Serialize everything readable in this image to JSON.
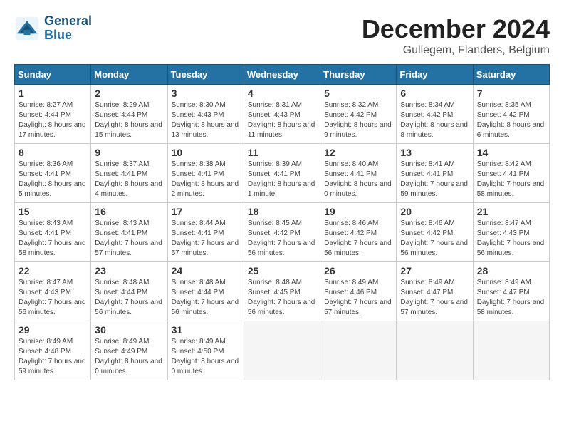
{
  "header": {
    "logo_line1": "General",
    "logo_line2": "Blue",
    "month": "December 2024",
    "location": "Gullegem, Flanders, Belgium"
  },
  "weekdays": [
    "Sunday",
    "Monday",
    "Tuesday",
    "Wednesday",
    "Thursday",
    "Friday",
    "Saturday"
  ],
  "weeks": [
    [
      {
        "day": "1",
        "info": "Sunrise: 8:27 AM\nSunset: 4:44 PM\nDaylight: 8 hours and 17 minutes."
      },
      {
        "day": "2",
        "info": "Sunrise: 8:29 AM\nSunset: 4:44 PM\nDaylight: 8 hours and 15 minutes."
      },
      {
        "day": "3",
        "info": "Sunrise: 8:30 AM\nSunset: 4:43 PM\nDaylight: 8 hours and 13 minutes."
      },
      {
        "day": "4",
        "info": "Sunrise: 8:31 AM\nSunset: 4:43 PM\nDaylight: 8 hours and 11 minutes."
      },
      {
        "day": "5",
        "info": "Sunrise: 8:32 AM\nSunset: 4:42 PM\nDaylight: 8 hours and 9 minutes."
      },
      {
        "day": "6",
        "info": "Sunrise: 8:34 AM\nSunset: 4:42 PM\nDaylight: 8 hours and 8 minutes."
      },
      {
        "day": "7",
        "info": "Sunrise: 8:35 AM\nSunset: 4:42 PM\nDaylight: 8 hours and 6 minutes."
      }
    ],
    [
      {
        "day": "8",
        "info": "Sunrise: 8:36 AM\nSunset: 4:41 PM\nDaylight: 8 hours and 5 minutes."
      },
      {
        "day": "9",
        "info": "Sunrise: 8:37 AM\nSunset: 4:41 PM\nDaylight: 8 hours and 4 minutes."
      },
      {
        "day": "10",
        "info": "Sunrise: 8:38 AM\nSunset: 4:41 PM\nDaylight: 8 hours and 2 minutes."
      },
      {
        "day": "11",
        "info": "Sunrise: 8:39 AM\nSunset: 4:41 PM\nDaylight: 8 hours and 1 minute."
      },
      {
        "day": "12",
        "info": "Sunrise: 8:40 AM\nSunset: 4:41 PM\nDaylight: 8 hours and 0 minutes."
      },
      {
        "day": "13",
        "info": "Sunrise: 8:41 AM\nSunset: 4:41 PM\nDaylight: 7 hours and 59 minutes."
      },
      {
        "day": "14",
        "info": "Sunrise: 8:42 AM\nSunset: 4:41 PM\nDaylight: 7 hours and 58 minutes."
      }
    ],
    [
      {
        "day": "15",
        "info": "Sunrise: 8:43 AM\nSunset: 4:41 PM\nDaylight: 7 hours and 58 minutes."
      },
      {
        "day": "16",
        "info": "Sunrise: 8:43 AM\nSunset: 4:41 PM\nDaylight: 7 hours and 57 minutes."
      },
      {
        "day": "17",
        "info": "Sunrise: 8:44 AM\nSunset: 4:41 PM\nDaylight: 7 hours and 57 minutes."
      },
      {
        "day": "18",
        "info": "Sunrise: 8:45 AM\nSunset: 4:42 PM\nDaylight: 7 hours and 56 minutes."
      },
      {
        "day": "19",
        "info": "Sunrise: 8:46 AM\nSunset: 4:42 PM\nDaylight: 7 hours and 56 minutes."
      },
      {
        "day": "20",
        "info": "Sunrise: 8:46 AM\nSunset: 4:42 PM\nDaylight: 7 hours and 56 minutes."
      },
      {
        "day": "21",
        "info": "Sunrise: 8:47 AM\nSunset: 4:43 PM\nDaylight: 7 hours and 56 minutes."
      }
    ],
    [
      {
        "day": "22",
        "info": "Sunrise: 8:47 AM\nSunset: 4:43 PM\nDaylight: 7 hours and 56 minutes."
      },
      {
        "day": "23",
        "info": "Sunrise: 8:48 AM\nSunset: 4:44 PM\nDaylight: 7 hours and 56 minutes."
      },
      {
        "day": "24",
        "info": "Sunrise: 8:48 AM\nSunset: 4:44 PM\nDaylight: 7 hours and 56 minutes."
      },
      {
        "day": "25",
        "info": "Sunrise: 8:48 AM\nSunset: 4:45 PM\nDaylight: 7 hours and 56 minutes."
      },
      {
        "day": "26",
        "info": "Sunrise: 8:49 AM\nSunset: 4:46 PM\nDaylight: 7 hours and 57 minutes."
      },
      {
        "day": "27",
        "info": "Sunrise: 8:49 AM\nSunset: 4:47 PM\nDaylight: 7 hours and 57 minutes."
      },
      {
        "day": "28",
        "info": "Sunrise: 8:49 AM\nSunset: 4:47 PM\nDaylight: 7 hours and 58 minutes."
      }
    ],
    [
      {
        "day": "29",
        "info": "Sunrise: 8:49 AM\nSunset: 4:48 PM\nDaylight: 7 hours and 59 minutes."
      },
      {
        "day": "30",
        "info": "Sunrise: 8:49 AM\nSunset: 4:49 PM\nDaylight: 8 hours and 0 minutes."
      },
      {
        "day": "31",
        "info": "Sunrise: 8:49 AM\nSunset: 4:50 PM\nDaylight: 8 hours and 0 minutes."
      },
      null,
      null,
      null,
      null
    ]
  ]
}
